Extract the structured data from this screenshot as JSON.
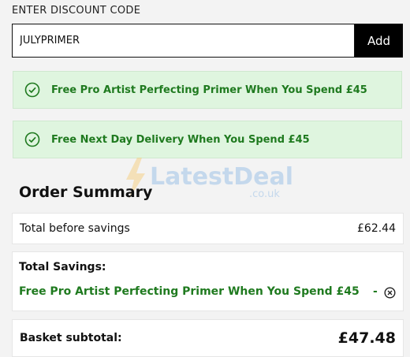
{
  "discount": {
    "label": "ENTER DISCOUNT CODE",
    "code_value": "JULYPRIMER",
    "add_label": "Add"
  },
  "promos": [
    {
      "text": "Free Pro Artist Perfecting Primer When You Spend £45",
      "icon": "check-circle-icon"
    },
    {
      "text": "Free Next Day Delivery When You Spend £45",
      "icon": "check-circle-icon"
    }
  ],
  "watermark": {
    "brand": "LatestDeals",
    "suffix": ".co.uk"
  },
  "summary": {
    "title": "Order Summary",
    "total_before_label": "Total before savings",
    "total_before_value": "£62.44",
    "savings_label": "Total Savings:",
    "savings_item": "Free Pro Artist Perfecting Primer When You Spend £45",
    "savings_dash": "-",
    "subtotal_label": "Basket subtotal:",
    "subtotal_value": "£47.48"
  },
  "colors": {
    "promo_bg": "#dff5df",
    "promo_text": "#1f7a1f",
    "button_bg": "#000000"
  }
}
